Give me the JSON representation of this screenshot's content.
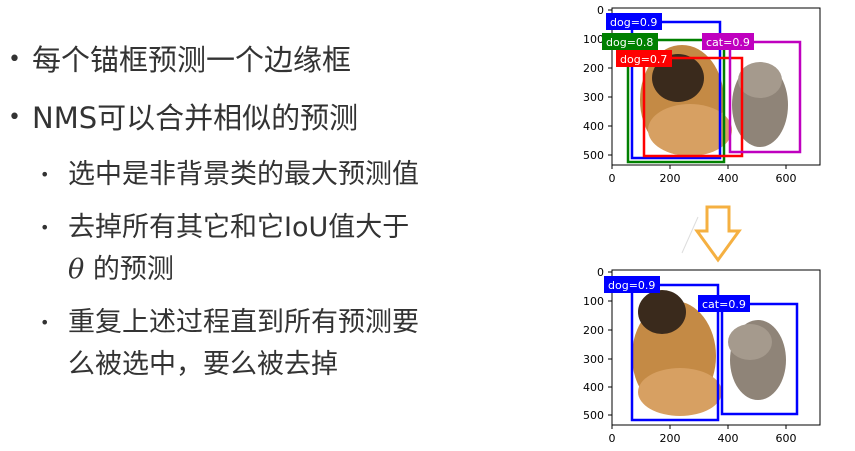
{
  "bullets": [
    {
      "level": 1,
      "text": "每个锚框预测一个边缘框"
    },
    {
      "level": 1,
      "text": "NMS可以合并相似的预测"
    },
    {
      "level": 2,
      "text": "选中是非背景类的最大预测值"
    },
    {
      "level": 2,
      "text": "去掉所有其它和它IoU值大于"
    },
    {
      "level": 2,
      "symbol": "θ",
      "text": "的预测"
    },
    {
      "level": 2,
      "text": "重复上述过程直到所有预测要"
    },
    {
      "level": 2,
      "text": "么被选中，要么被去掉"
    }
  ],
  "plot_before": {
    "y_ticks": [
      "0",
      "100",
      "200",
      "300",
      "400",
      "500"
    ],
    "x_ticks": [
      "0",
      "200",
      "400",
      "600"
    ],
    "boxes": [
      {
        "label": "dog=0.9",
        "color": "#0000ff"
      },
      {
        "label": "dog=0.8",
        "color": "#008000"
      },
      {
        "label": "dog=0.7",
        "color": "#ff0000"
      },
      {
        "label": "cat=0.9",
        "color": "#bf00bf"
      }
    ]
  },
  "plot_after": {
    "y_ticks": [
      "0",
      "100",
      "200",
      "300",
      "400",
      "500"
    ],
    "x_ticks": [
      "0",
      "200",
      "400",
      "600"
    ],
    "boxes": [
      {
        "label": "dog=0.9",
        "color": "#0000ff"
      },
      {
        "label": "cat=0.9",
        "color": "#0000ff"
      }
    ]
  },
  "arrow_color": "#f5b041"
}
